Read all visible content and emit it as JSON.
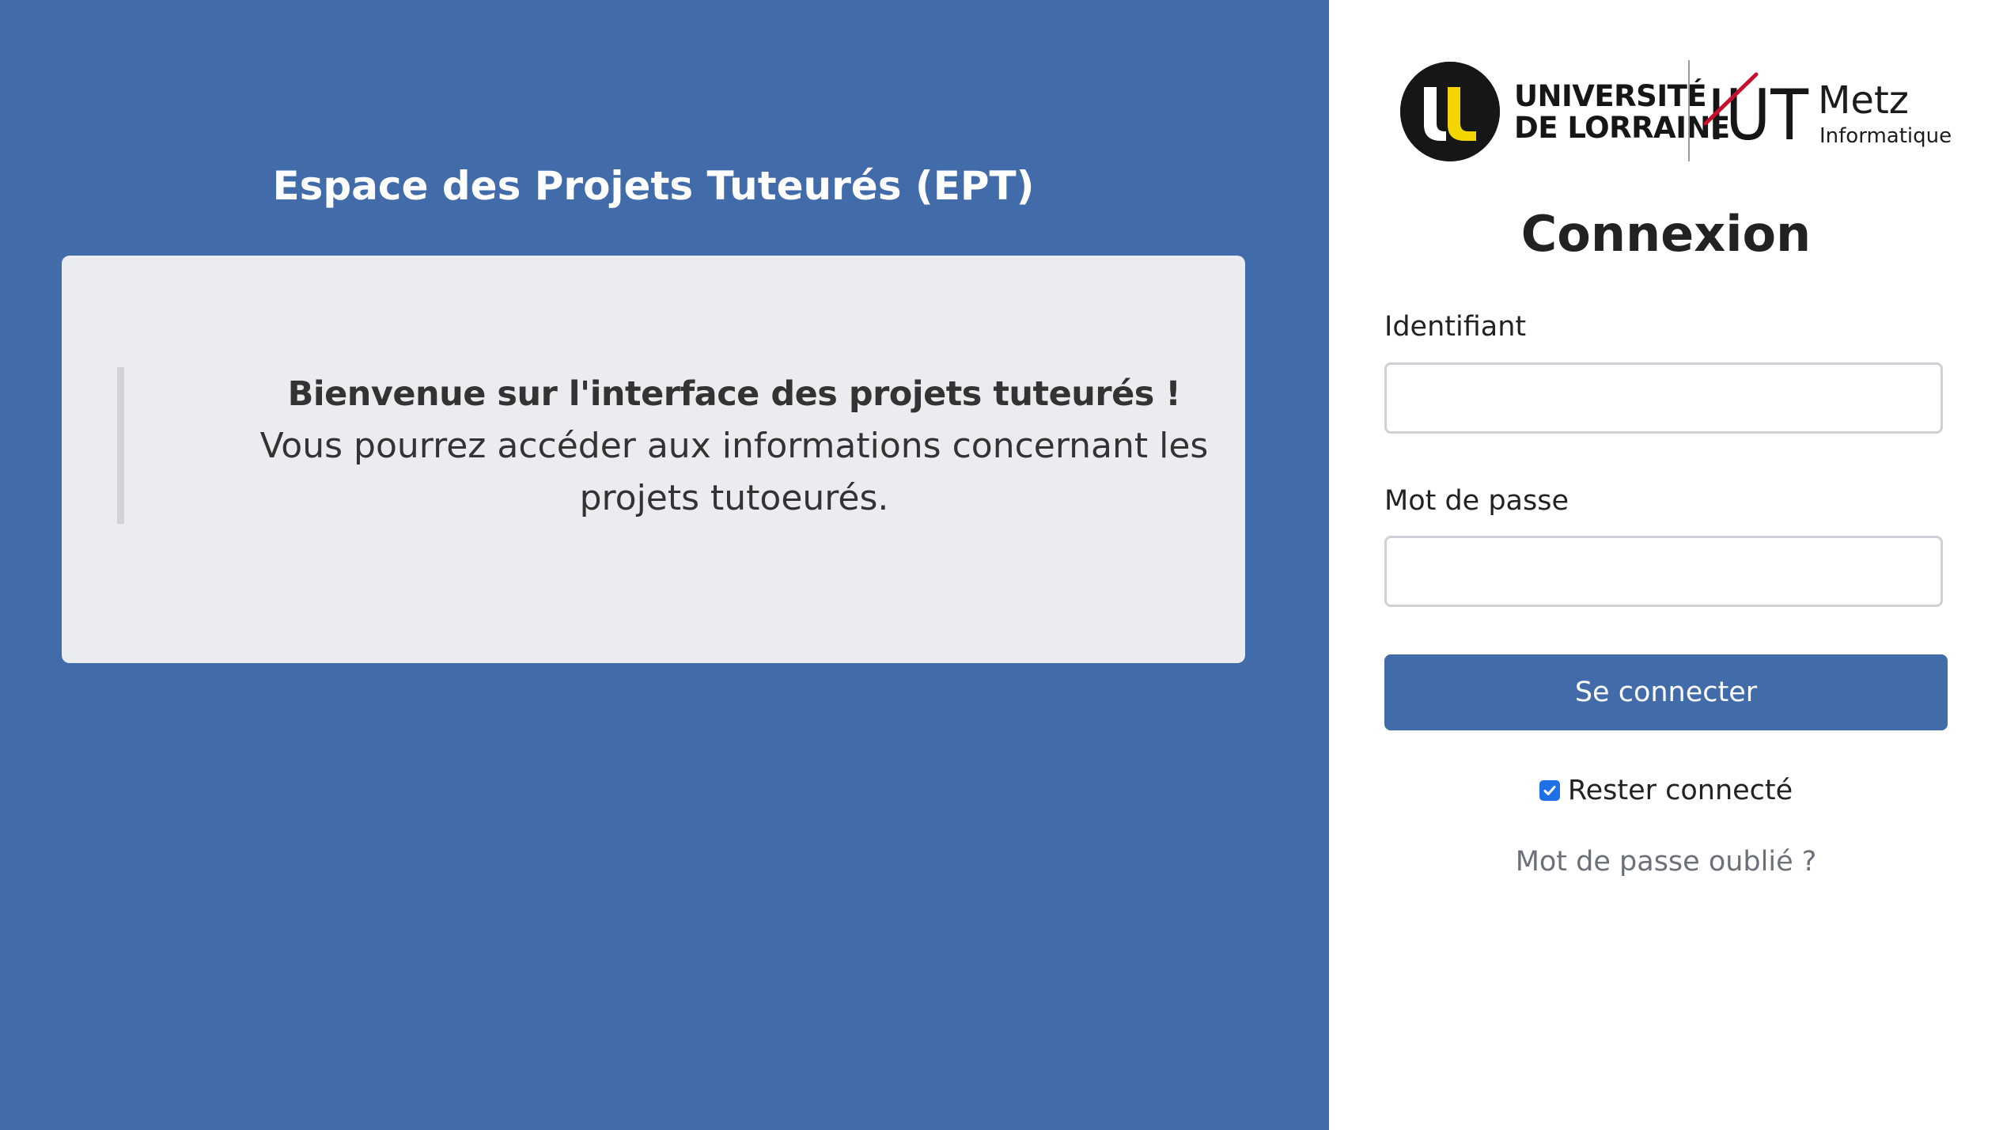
{
  "left_panel": {
    "title": "Espace des Projets Tuteurés (EPT)",
    "welcome": {
      "heading": "Bienvenue sur l'interface des projets tuteurés !",
      "body": "Vous pourrez accéder aux informations concernant les projets tutoeurés."
    },
    "background_color": "#426baa"
  },
  "logos": {
    "university": {
      "line1": "UNIVERSITÉ",
      "line2": "DE LORRAINE",
      "emblem_colors": [
        "#161616",
        "#ffffff",
        "#f3d500"
      ]
    },
    "iut": {
      "mark": "IUT",
      "city": "Metz",
      "department": "Informatique",
      "accent_color": "#c8102e"
    }
  },
  "login": {
    "title": "Connexion",
    "username": {
      "label": "Identifiant",
      "value": "",
      "placeholder": ""
    },
    "password": {
      "label": "Mot de passe",
      "value": "",
      "placeholder": ""
    },
    "submit_label": "Se connecter",
    "remember_me": {
      "label": "Rester connecté",
      "checked": true
    },
    "forgot_password": "Mot de passe oublié ?"
  },
  "colors": {
    "primary": "#426baa",
    "card_background": "#ebecf0",
    "checkbox": "#1f6fe8",
    "muted_link": "#6c7078"
  }
}
